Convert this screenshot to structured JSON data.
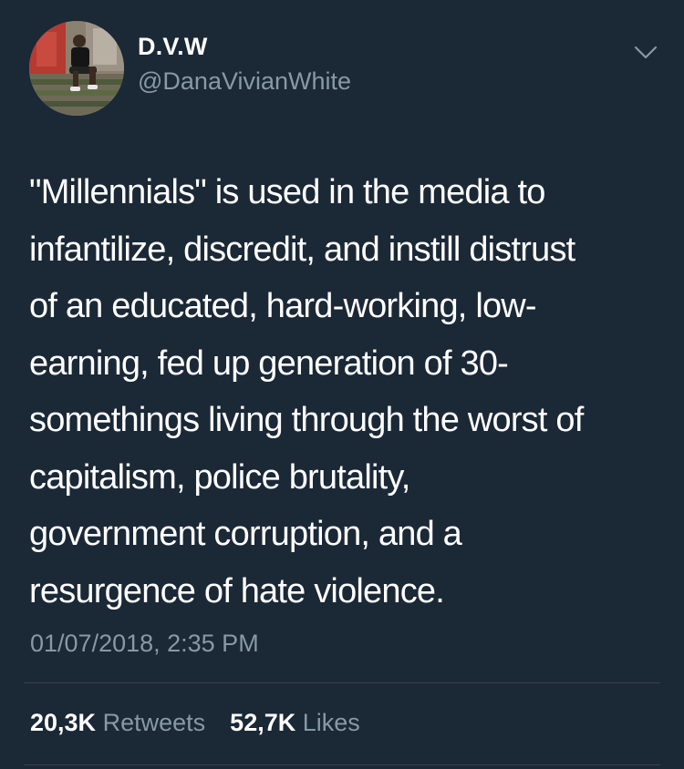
{
  "author": {
    "display_name": "D.V.W",
    "handle": "@DanaVivianWhite"
  },
  "tweet": {
    "lines": [
      "\"Millennials\" is used in the media to",
      "infantilize, discredit, and instill distrust",
      "of an educated, hard-working, low-",
      "earning, fed up generation of 30-",
      "somethings living through the worst of",
      "capitalism, police brutality,",
      "government corruption, and a",
      "resurgence of hate violence."
    ],
    "timestamp": "01/07/2018, 2:35 PM"
  },
  "stats": {
    "retweets_count": "20,3K",
    "retweets_label": "Retweets",
    "likes_count": "52,7K",
    "likes_label": "Likes"
  },
  "colors": {
    "background": "#1b2836",
    "primary_text": "#ffffff",
    "secondary_text": "#8899a6",
    "divider": "#38444d"
  },
  "icons": {
    "menu": "chevron-down-icon"
  }
}
